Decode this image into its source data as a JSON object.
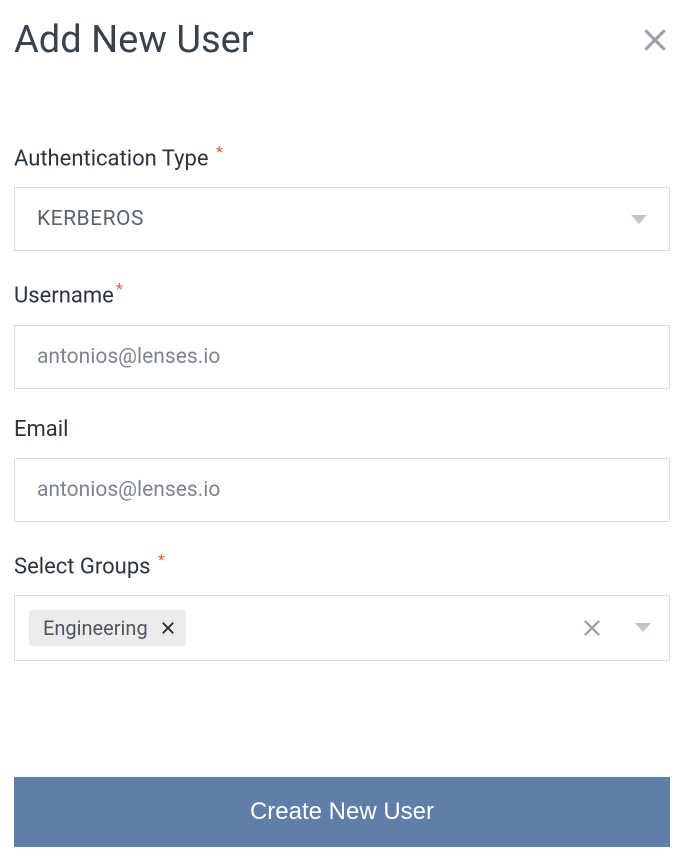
{
  "header": {
    "title": "Add New User"
  },
  "authType": {
    "label": "Authentication Type",
    "required": "*",
    "value": "KERBEROS"
  },
  "username": {
    "label": "Username",
    "required": "*",
    "value": "antonios@lenses.io"
  },
  "email": {
    "label": "Email",
    "value": "antonios@lenses.io"
  },
  "groups": {
    "label": "Select Groups",
    "required": "*",
    "chips": [
      {
        "label": "Engineering"
      }
    ]
  },
  "submit": {
    "label": "Create New User"
  }
}
